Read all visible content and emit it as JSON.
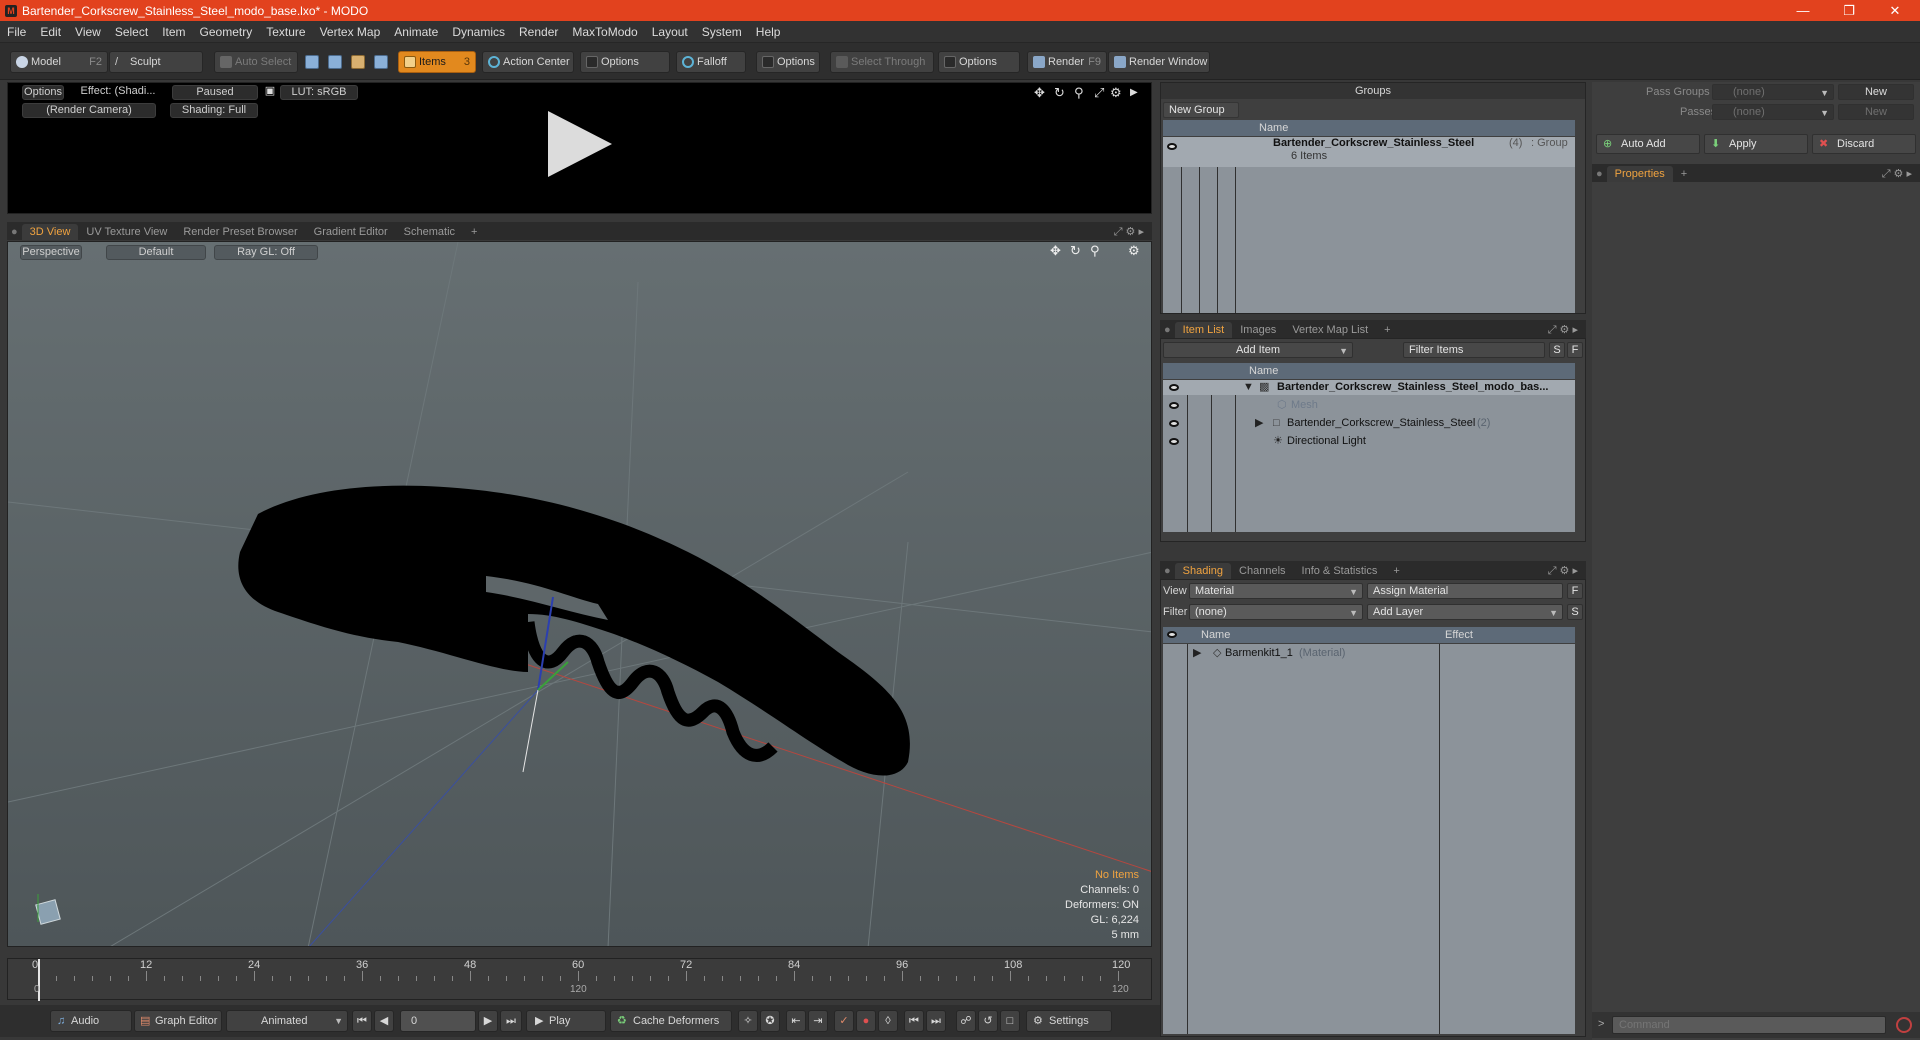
{
  "window": {
    "title": "Bartender_Corkscrew_Stainless_Steel_modo_base.lxo* - MODO"
  },
  "menu": [
    "File",
    "Edit",
    "View",
    "Select",
    "Item",
    "Geometry",
    "Texture",
    "Vertex Map",
    "Animate",
    "Dynamics",
    "Render",
    "MaxToModo",
    "Layout",
    "System",
    "Help"
  ],
  "toolbar": {
    "model": "Model",
    "model_key": "F2",
    "sculpt": "Sculpt",
    "auto_select": "Auto Select",
    "items": "Items",
    "items_key": "3",
    "action_center": "Action Center",
    "options1": "Options",
    "falloff": "Falloff",
    "options2": "Options",
    "select_through": "Select Through",
    "options3": "Options",
    "render": "Render",
    "render_key": "F9",
    "render_window": "Render Window"
  },
  "preview": {
    "options": "Options",
    "effect": "Effect: (Shadi...",
    "paused": "Paused",
    "lut": "LUT: sRGB",
    "camera": "(Render Camera)",
    "shading": "Shading: Full"
  },
  "view_tabs": [
    "3D View",
    "UV Texture View",
    "Render Preset Browser",
    "Gradient Editor",
    "Schematic"
  ],
  "viewport": {
    "perspective": "Perspective",
    "default": "Default",
    "raygl": "Ray GL: Off",
    "stats": {
      "items": "No Items",
      "channels": "Channels: 0",
      "deformers": "Deformers: ON",
      "gl": "GL: 6,224",
      "unit": "5 mm"
    }
  },
  "timeline": {
    "ticks": [
      "0",
      "12",
      "24",
      "36",
      "48",
      "60",
      "72",
      "84",
      "96",
      "108",
      "120"
    ],
    "sub_left": "0",
    "sub_mid": "120",
    "sub_right": "120"
  },
  "bottom": {
    "audio": "Audio",
    "graph_editor": "Graph Editor",
    "animated": "Animated",
    "frame": "0",
    "play": "Play",
    "cache": "Cache Deformers",
    "settings": "Settings"
  },
  "groups": {
    "title": "Groups",
    "new_group": "New Group",
    "col_name": "Name",
    "item_name": "Bartender_Corkscrew_Stainless_Steel",
    "item_count": "(4)",
    "item_type": ": Group",
    "item_sub": "6 Items"
  },
  "pass": {
    "pass_groups": "Pass Groups",
    "passes": "Passes",
    "none1": "(none)",
    "none2": "(none)",
    "new1": "New",
    "new2": "New"
  },
  "actions": {
    "auto_add": "Auto Add",
    "apply": "Apply",
    "discard": "Discard"
  },
  "properties": {
    "tab": "Properties"
  },
  "item_tabs": [
    "Item List",
    "Images",
    "Vertex Map List"
  ],
  "item_list": {
    "add_item": "Add Item",
    "filter": "Filter Items",
    "s": "S",
    "f": "F",
    "col_name": "Name",
    "rows": [
      {
        "label": "Bartender_Corkscrew_Stainless_Steel_modo_bas...",
        "extra": ""
      },
      {
        "label": "Mesh",
        "extra": ""
      },
      {
        "label": "Bartender_Corkscrew_Stainless_Steel",
        "extra": "(2)"
      },
      {
        "label": "Directional Light",
        "extra": ""
      }
    ]
  },
  "shading_tabs": [
    "Shading",
    "Channels",
    "Info & Statistics"
  ],
  "shading": {
    "view_label": "View",
    "view_value": "Material",
    "assign": "Assign Material",
    "f": "F",
    "filter_label": "Filter",
    "filter_value": "(none)",
    "add_layer": "Add Layer",
    "s": "S",
    "col_name": "Name",
    "col_effect": "Effect",
    "row_label": "Barmenkit1_1",
    "row_type": "(Material)"
  },
  "command": {
    "placeholder": "Command"
  }
}
